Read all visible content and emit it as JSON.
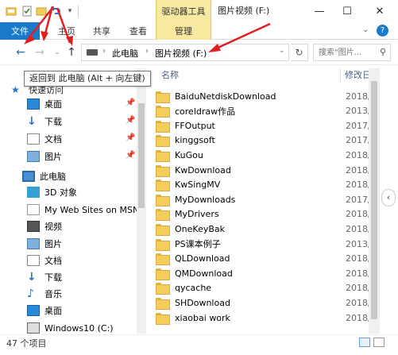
{
  "window": {
    "context_tab": "驱动器工具",
    "title": "图片视频 (F:)",
    "minimize": "—",
    "maximize": "☐",
    "close": "✕"
  },
  "ribbon": {
    "file": "文件",
    "tabs": [
      "主页",
      "共享",
      "查看",
      "管理"
    ],
    "help": "?"
  },
  "address": {
    "crumbs": [
      "此电脑",
      "图片视频 (F:)"
    ],
    "search_placeholder": "搜索\"图片..."
  },
  "tooltip": "返回到 此电脑 (Alt + 向左键)",
  "nav": {
    "quick_access_label": "快速访问",
    "quick_items": [
      {
        "label": "桌面",
        "icon": "desktop-icon",
        "pinned": true
      },
      {
        "label": "下载",
        "icon": "download-icon",
        "pinned": true
      },
      {
        "label": "文档",
        "icon": "documents-icon",
        "pinned": true
      },
      {
        "label": "图片",
        "icon": "pictures-icon",
        "pinned": true
      }
    ],
    "this_pc_label": "此电脑",
    "pc_items": [
      {
        "label": "3D 对象",
        "icon": "3d-objects-icon"
      },
      {
        "label": "My Web Sites on MSN",
        "icon": "web-sites-icon"
      },
      {
        "label": "视频",
        "icon": "videos-icon"
      },
      {
        "label": "图片",
        "icon": "pictures-icon"
      },
      {
        "label": "文档",
        "icon": "documents-icon"
      },
      {
        "label": "下载",
        "icon": "download-icon"
      },
      {
        "label": "音乐",
        "icon": "music-icon"
      },
      {
        "label": "桌面",
        "icon": "desktop-icon"
      },
      {
        "label": "Windows10 (C:)",
        "icon": "drive-icon"
      }
    ]
  },
  "columns": {
    "name": "名称",
    "modified": "修改日"
  },
  "files": [
    {
      "name": "BaiduNetdiskDownload",
      "date": "2018/"
    },
    {
      "name": "coreldraw作品",
      "date": "2013/"
    },
    {
      "name": "FFOutput",
      "date": "2017/"
    },
    {
      "name": "kinggsoft",
      "date": "2017/"
    },
    {
      "name": "KuGou",
      "date": "2018/"
    },
    {
      "name": "KwDownload",
      "date": "2018/"
    },
    {
      "name": "KwSingMV",
      "date": "2018/"
    },
    {
      "name": "MyDownloads",
      "date": "2017/"
    },
    {
      "name": "MyDrivers",
      "date": "2018/"
    },
    {
      "name": "OneKeyBak",
      "date": "2018/"
    },
    {
      "name": "PS课本例子",
      "date": "2013/"
    },
    {
      "name": "QLDownload",
      "date": "2018/"
    },
    {
      "name": "QMDownload",
      "date": "2018/"
    },
    {
      "name": "qycache",
      "date": "2018/"
    },
    {
      "name": "SHDownload",
      "date": "2018/"
    },
    {
      "name": "xiaobai work",
      "date": "2018/"
    }
  ],
  "status": {
    "count": "47 个项目"
  },
  "colors": {
    "file_tab": "#1979ca",
    "context_tab": "#f7e9a0",
    "column_header": "#4d6185",
    "annotation_arrow": "#e02020"
  }
}
